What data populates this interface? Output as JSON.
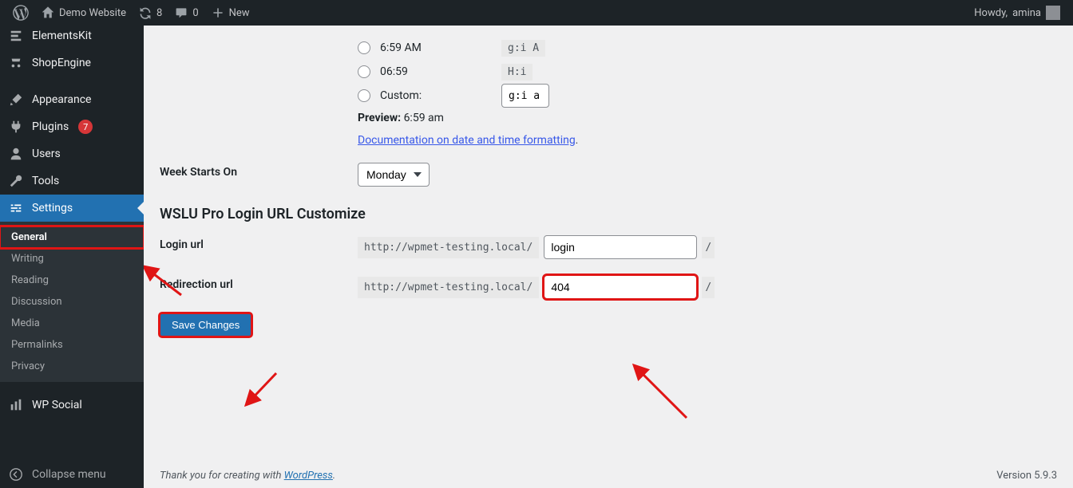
{
  "adminbar": {
    "site_name": "Demo Website",
    "updates_count": "8",
    "comments_count": "0",
    "new_label": "New",
    "howdy_prefix": "Howdy,",
    "user_name": "amina"
  },
  "sidebar": {
    "elementskit": "ElementsKit",
    "shopengine": "ShopEngine",
    "appearance": "Appearance",
    "plugins": "Plugins",
    "plugins_badge": "7",
    "users": "Users",
    "tools": "Tools",
    "settings": "Settings",
    "submenu": {
      "general": "General",
      "writing": "Writing",
      "reading": "Reading",
      "discussion": "Discussion",
      "media": "Media",
      "permalinks": "Permalinks",
      "privacy": "Privacy"
    },
    "wpsocial": "WP Social",
    "collapse": "Collapse menu"
  },
  "time_format": {
    "opt1_label": "6:59 AM",
    "opt1_code": "g:i A",
    "opt2_label": "06:59",
    "opt2_code": "H:i",
    "custom_label": "Custom:",
    "custom_value": "g:i a",
    "preview_label": "Preview:",
    "preview_value": "6:59 am",
    "doc_link": "Documentation on date and time formatting"
  },
  "week": {
    "label": "Week Starts On",
    "value": "Monday"
  },
  "wslu": {
    "heading": "WSLU Pro Login URL Customize",
    "login_label": "Login url",
    "redirect_label": "Redirection url",
    "prefix": "http://wpmet-testing.local/",
    "login_value": "login",
    "redirect_value": "404",
    "slash": "/"
  },
  "save_label": "Save Changes",
  "footer": {
    "thanks_prefix": "Thank you for creating with ",
    "wp_text": "WordPress",
    "thanks_suffix": ".",
    "version": "Version 5.9.3"
  }
}
